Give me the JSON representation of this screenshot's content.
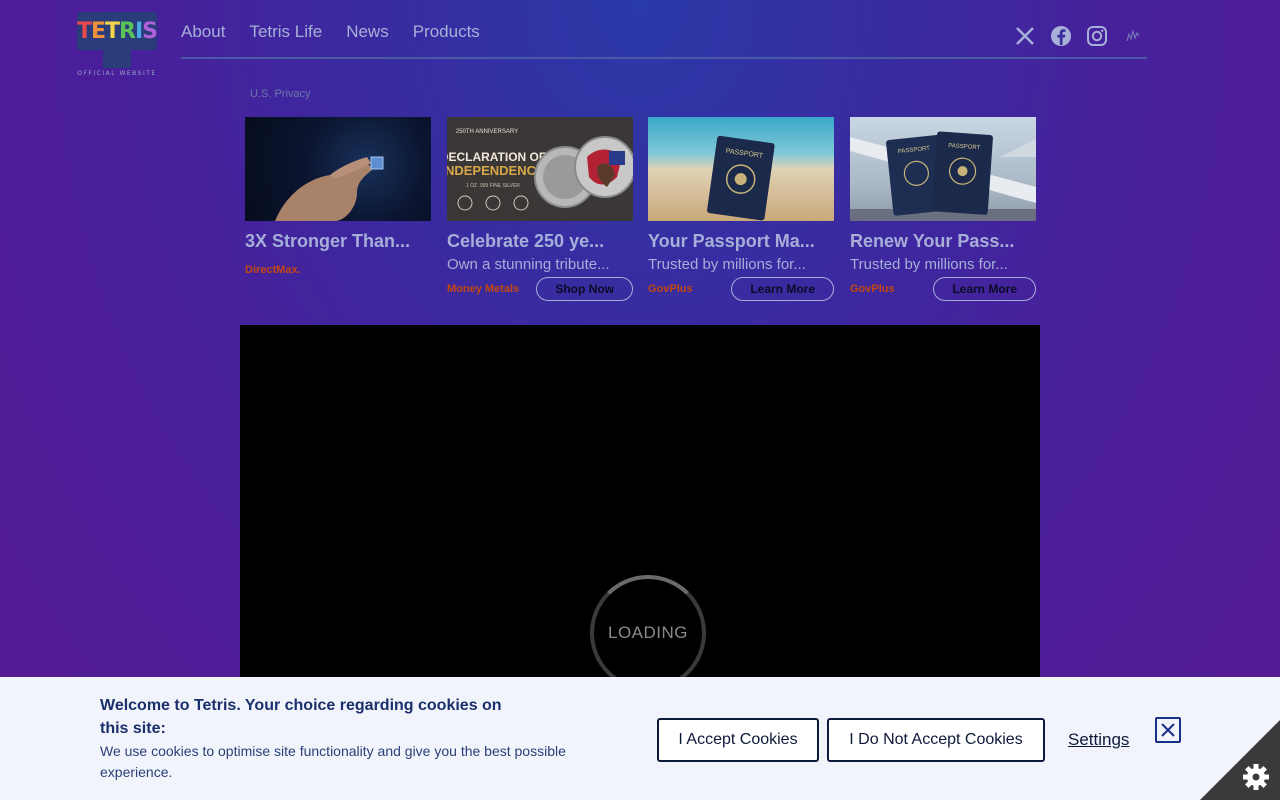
{
  "logo": {
    "letters": [
      "T",
      "E",
      "T",
      "R",
      "I",
      "S"
    ],
    "sub": "OFFICIAL WEBSITE"
  },
  "nav": {
    "items": [
      "About",
      "Tetris Life",
      "News",
      "Products"
    ]
  },
  "social": {
    "icons": [
      "x-icon",
      "facebook-icon",
      "instagram-icon",
      "tiktok-icon"
    ]
  },
  "privacy": "U.S. Privacy",
  "ads": [
    {
      "title": "3X Stronger Than...",
      "desc": "",
      "source": "DirectMax.",
      "button": ""
    },
    {
      "title": "Celebrate 250 ye...",
      "desc": "Own a stunning tribute...",
      "source": "Money Metals",
      "button": "Shop Now"
    },
    {
      "title": "Your Passport Ma...",
      "desc": "Trusted by millions for...",
      "source": "GovPlus",
      "button": "Learn More"
    },
    {
      "title": "Renew Your Pass...",
      "desc": "Trusted by millions for...",
      "source": "GovPlus",
      "button": "Learn More"
    }
  ],
  "ad_images": {
    "coin_top": "250TH ANNIVERSARY",
    "coin_mid1": "DECLARATION OF",
    "coin_mid2": "INDEPENDENCE",
    "coin_sub": "1 OZ .999 FINE SILVER",
    "passport": "PASSPORT"
  },
  "video": {
    "loading": "LOADING"
  },
  "cookie": {
    "title": "Welcome to Tetris. Your choice regarding cookies on this site:",
    "text": "We use cookies to optimise site functionality and give you the best possible experience.",
    "accept": "I Accept Cookies",
    "deny": "I Do Not Accept Cookies",
    "settings": "Settings"
  },
  "colors": {
    "accent": "#1a2f6b",
    "ad_source": "#c2470f"
  }
}
